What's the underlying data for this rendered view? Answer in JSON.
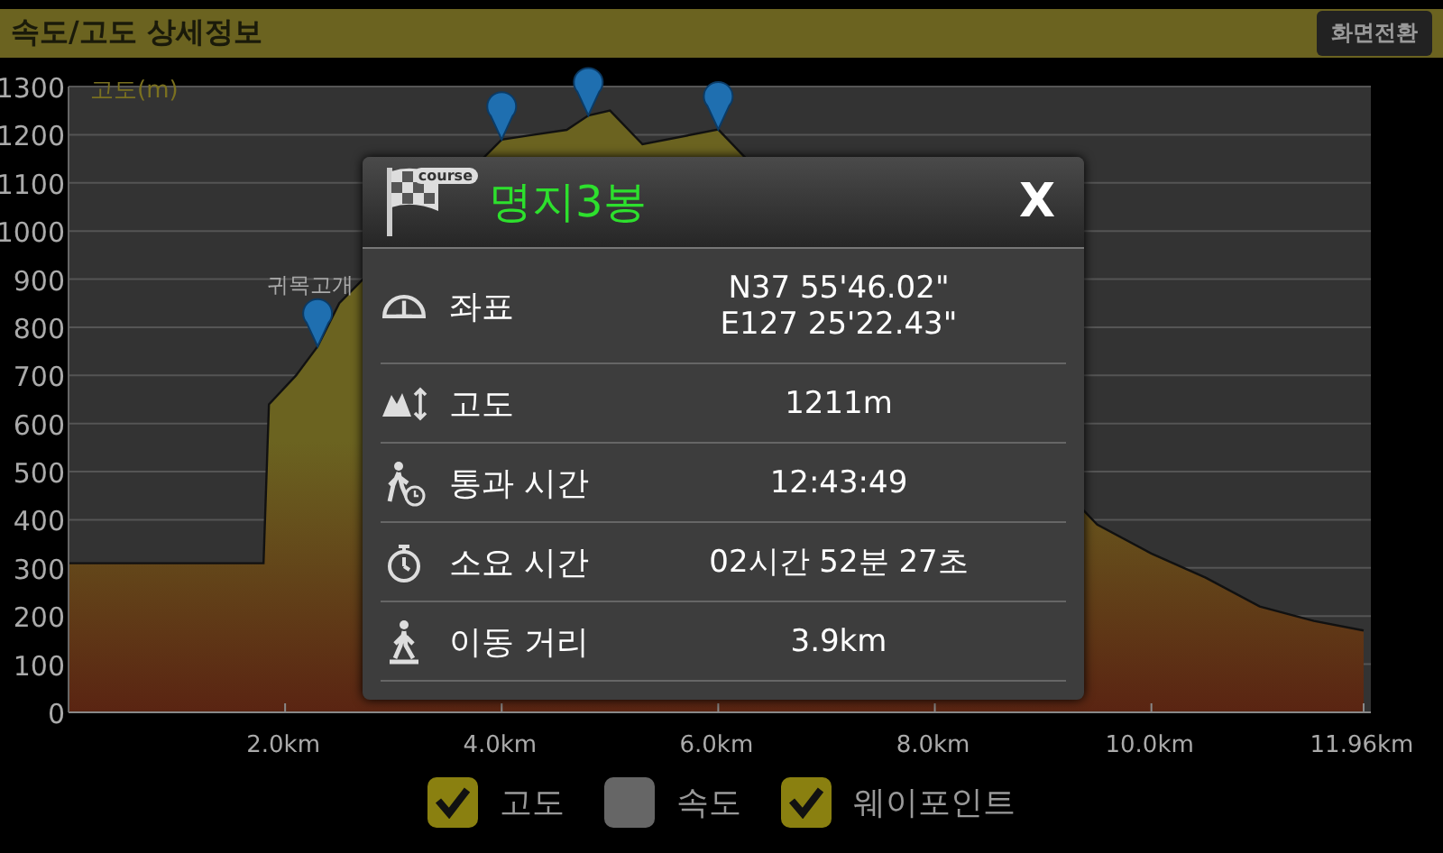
{
  "header": {
    "title": "속도/고도 상세정보",
    "button": "화면전환"
  },
  "chart": {
    "chart_data": {
      "type": "area",
      "ylabel": "고도(m)",
      "x": [
        0,
        0.5,
        1.0,
        1.8,
        1.85,
        2.1,
        2.3,
        2.5,
        2.8,
        3.2,
        3.6,
        4.0,
        4.3,
        4.6,
        4.8,
        5.0,
        5.3,
        5.6,
        6.0,
        6.3,
        6.8,
        7.5,
        8.3,
        9.0,
        9.5,
        10.0,
        10.5,
        11.0,
        11.5,
        11.96
      ],
      "series": [
        {
          "color": "#6b6320",
          "values": [
            310,
            310,
            310,
            310,
            640,
            700,
            760,
            850,
            null,
            null,
            null,
            1190,
            1200,
            1210,
            1240,
            1250,
            1180,
            null,
            1211,
            null,
            null,
            null,
            null,
            null,
            390,
            330,
            280,
            220,
            190,
            170
          ]
        }
      ],
      "grid": true,
      "xlim": [
        0,
        11.96
      ],
      "ylim": [
        0,
        1300
      ],
      "yticks": [
        0,
        100,
        200,
        300,
        400,
        500,
        600,
        700,
        800,
        900,
        1000,
        1100,
        1200,
        1300
      ],
      "xticks": [
        {
          "value": 2,
          "label": "2.0km"
        },
        {
          "value": 4,
          "label": "4.0km"
        },
        {
          "value": 6,
          "label": "6.0km"
        },
        {
          "value": 8,
          "label": "8.0km"
        },
        {
          "value": 10,
          "label": "10.0km"
        },
        {
          "value": 11.96,
          "label": "11.96km"
        }
      ],
      "annotations": [
        "귀목고개"
      ]
    }
  },
  "dialog": {
    "badge": "course",
    "title": "명지3봉",
    "close": "X",
    "rows": [
      {
        "kind": "coordinates",
        "label": "좌표",
        "values": [
          "N37 55'46.02\"",
          "E127 25'22.43\""
        ]
      },
      {
        "kind": "altitude",
        "label": "고도",
        "values": [
          "1211m"
        ]
      },
      {
        "kind": "pass_time",
        "label": "통과 시간",
        "values": [
          "12:43:49"
        ]
      },
      {
        "kind": "duration",
        "label": "소요 시간",
        "values": [
          "02시간 52분 27초"
        ]
      },
      {
        "kind": "distance",
        "label": "이동 거리",
        "values": [
          "3.9km"
        ]
      }
    ]
  },
  "legend": [
    {
      "label": "고도",
      "checked": true
    },
    {
      "label": "속도",
      "checked": false
    },
    {
      "label": "웨이포인트",
      "checked": true
    }
  ]
}
